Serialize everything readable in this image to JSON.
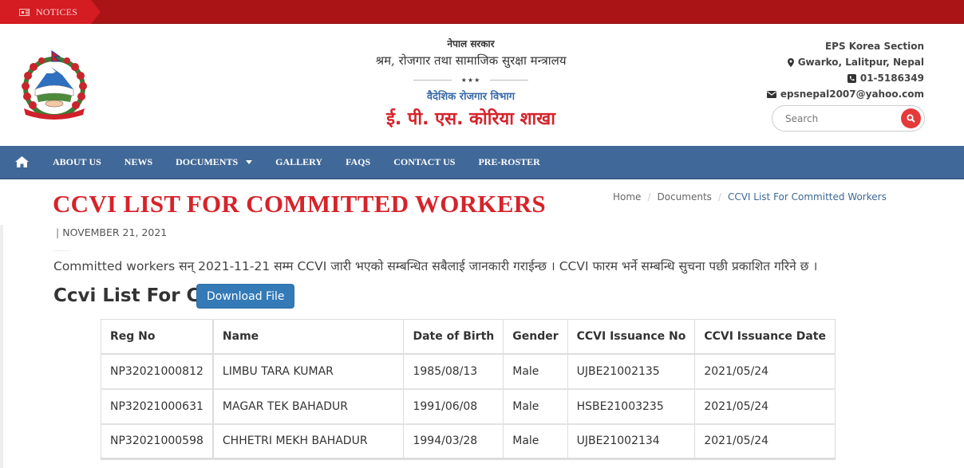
{
  "notice_bar": {
    "label": "NOTICES",
    "icon": "newspaper-icon"
  },
  "header": {
    "government": "नेपाल सरकार",
    "ministry": "श्रम, रोजगार तथा सामाजिक सुरक्षा मन्त्रालय",
    "stars": "★★★",
    "department": "वैदेशिक रोजगार विभाग",
    "branch": "ई. पी. एस. कोरिया शाखा",
    "contact": {
      "office": "EPS Korea Section",
      "address": "Gwarko, Lalitpur, Nepal",
      "phone": "01-5186349",
      "email": "epsnepal2007@yahoo.com"
    },
    "search": {
      "placeholder": "Search",
      "value": ""
    }
  },
  "nav": {
    "items": [
      {
        "label": "ABOUT US"
      },
      {
        "label": "NEWS"
      },
      {
        "label": "DOCUMENTS",
        "dropdown": true
      },
      {
        "label": "GALLERY"
      },
      {
        "label": "FAQS"
      },
      {
        "label": "CONTACT US"
      },
      {
        "label": "PRE-ROSTER"
      }
    ]
  },
  "colors": {
    "accent_red": "#d6232a",
    "nav_blue": "#406898",
    "button_blue": "#337ab7",
    "notice_red": "#ab1416"
  },
  "breadcrumb": {
    "items": [
      "Home",
      "Documents",
      "CCVI List For Committed Workers"
    ],
    "separator": "/"
  },
  "page": {
    "title": "CCVI LIST FOR COMMITTED WORKERS",
    "date": "NOVEMBER 21, 2021",
    "date_separator": "|",
    "intro": "Committed workers सन्  2021-11-21 सम्म CCVI जारी भएको सम्बन्धित सबैलाई जानकारी गराईन्छ । CCVI फारम भर्ने सम्बन्धि सुचना पछी प्रकाशित गरिने छ ।",
    "subtitle": "Ccvi List For Cw",
    "download_label": "Download File"
  },
  "table": {
    "headers": [
      "Reg No",
      "Name",
      "Date of Birth",
      "Gender",
      "CCVI Issuance No",
      "CCVI Issuance Date"
    ],
    "rows": [
      [
        "NP32021000812",
        "LIMBU TARA KUMAR",
        "1985/08/13",
        "Male",
        "UJBE21002135",
        "2021/05/24"
      ],
      [
        "NP32021000631",
        "MAGAR TEK BAHADUR",
        "1991/06/08",
        "Male",
        "HSBE21003235",
        "2021/05/24"
      ],
      [
        "NP32021000598",
        "CHHETRI MEKH BAHADUR",
        "1994/03/28",
        "Male",
        "UJBE21002134",
        "2021/05/24"
      ]
    ]
  }
}
